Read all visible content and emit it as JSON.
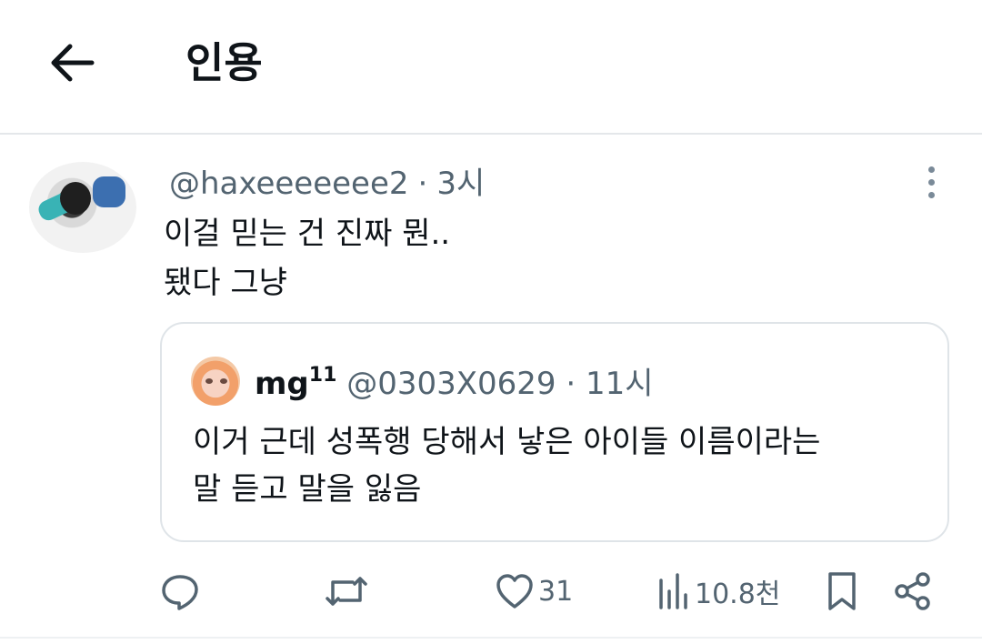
{
  "header": {
    "title": "인용"
  },
  "tweet": {
    "handle": "@haxeeeeeee2",
    "separator": "·",
    "time": "3시",
    "text_lines": [
      "이걸 믿는 건 진짜 뭔..",
      "됐다 그냥"
    ]
  },
  "quoted": {
    "name": "mg",
    "name_sup": "11",
    "handle": "@0303X0629",
    "separator": "·",
    "time": "11시",
    "text_lines": [
      "이거 근데 성폭행 당해서 낳은 아이들 이름이라는",
      "말 듣고 말을 잃음"
    ]
  },
  "actions": {
    "likes": "31",
    "views": "10.8천"
  },
  "colors": {
    "text": "#0f1419",
    "secondary": "#536471",
    "border": "#dfe4e8"
  },
  "icons": [
    "back-arrow-icon",
    "more-vertical-icon",
    "reply-icon",
    "retweet-icon",
    "heart-icon",
    "views-icon",
    "bookmark-icon",
    "share-icon"
  ]
}
